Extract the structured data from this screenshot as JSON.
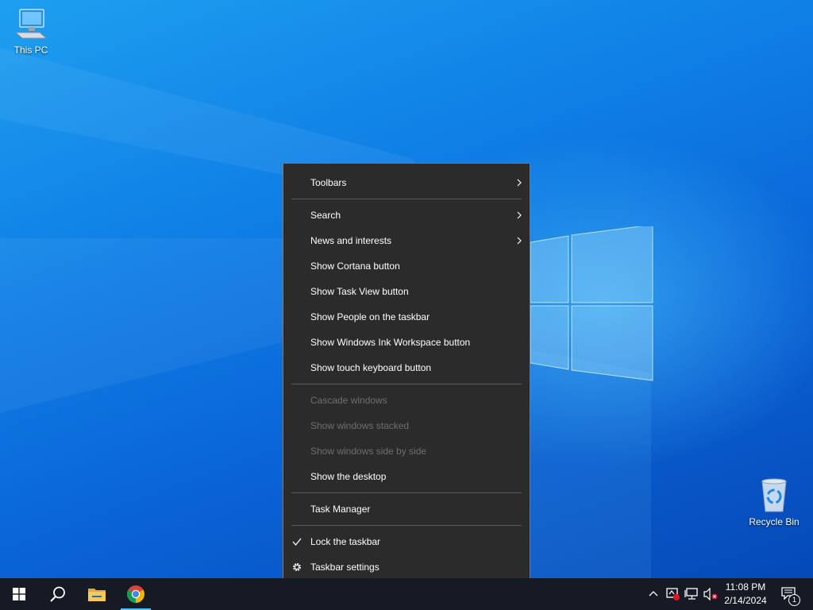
{
  "desktop": {
    "icons": [
      {
        "label": "This PC",
        "icon": "this-pc-icon"
      },
      {
        "label": "Recycle Bin",
        "icon": "recycle-bin-icon"
      }
    ]
  },
  "context_menu": {
    "items": [
      {
        "label": "Toolbars",
        "submenu": true,
        "enabled": true
      },
      {
        "label": "Search",
        "submenu": true,
        "enabled": true
      },
      {
        "label": "News and interests",
        "submenu": true,
        "enabled": true
      },
      {
        "label": "Show Cortana button",
        "enabled": true
      },
      {
        "label": "Show Task View button",
        "enabled": true
      },
      {
        "label": "Show People on the taskbar",
        "enabled": true
      },
      {
        "label": "Show Windows Ink Workspace button",
        "enabled": true
      },
      {
        "label": "Show touch keyboard button",
        "enabled": true
      },
      {
        "label": "Cascade windows",
        "enabled": false
      },
      {
        "label": "Show windows stacked",
        "enabled": false
      },
      {
        "label": "Show windows side by side",
        "enabled": false
      },
      {
        "label": "Show the desktop",
        "enabled": true
      },
      {
        "label": "Task Manager",
        "enabled": true
      },
      {
        "label": "Lock the taskbar",
        "enabled": true,
        "checked": true
      },
      {
        "label": "Taskbar settings",
        "enabled": true,
        "icon": "gear-icon"
      }
    ]
  },
  "taskbar": {
    "pinned": [
      {
        "name": "start-button",
        "icon": "windows-logo-icon"
      },
      {
        "name": "search-button",
        "icon": "search-icon"
      },
      {
        "name": "file-explorer-button",
        "icon": "folder-icon"
      },
      {
        "name": "chrome-button",
        "icon": "chrome-icon",
        "active": true
      }
    ],
    "tray": {
      "time": "11:08 PM",
      "date": "2/14/2024",
      "notification_count": "1"
    }
  },
  "colors": {
    "menu_bg": "#2b2b2b",
    "menu_disabled_text": "#6f6f6f",
    "taskbar_bg": "#151a24",
    "accent": "#4cc2ff"
  }
}
